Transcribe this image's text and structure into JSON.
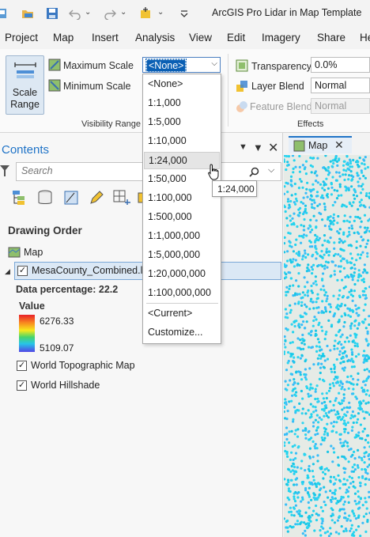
{
  "app": {
    "title": "ArcGIS Pro Lidar in Map Template"
  },
  "quick_access": [
    {
      "icon": "new-project-icon"
    },
    {
      "icon": "open-folder-icon"
    },
    {
      "icon": "save-icon"
    },
    {
      "icon": "undo-icon"
    },
    {
      "icon": "redo-icon"
    },
    {
      "icon": "new-item-icon"
    },
    {
      "icon": "customize-toolbar-icon"
    }
  ],
  "menu": {
    "tabs": [
      "Project",
      "Map",
      "Insert",
      "Analysis",
      "View",
      "Edit",
      "Imagery",
      "Share",
      "He"
    ]
  },
  "ribbon": {
    "scale_range": {
      "line1": "Scale",
      "line2": "Range"
    },
    "maximum_scale_label": "Maximum Scale",
    "maximum_scale_value": "<None>",
    "minimum_scale_label": "Minimum Scale",
    "visibility_group": "Visibility Range",
    "transparency_label": "Transparency",
    "transparency_value": "0.0%",
    "layer_blend_label": "Layer Blend",
    "layer_blend_value": "Normal",
    "feature_blend_label": "Feature Blend",
    "feature_blend_value": "Normal",
    "effects_group": "Effects"
  },
  "scale_dropdown": {
    "items": [
      "<None>",
      "1:1,000",
      "1:5,000",
      "1:10,000",
      "1:24,000",
      "1:50,000",
      "1:100,000",
      "1:500,000",
      "1:1,000,000",
      "1:5,000,000",
      "1:20,000,000",
      "1:100,000,000"
    ],
    "extra": [
      "<Current>",
      "Customize..."
    ],
    "hovered": "1:24,000",
    "tooltip": "1:24,000"
  },
  "contents": {
    "title": "Contents",
    "search_placeholder": "Search",
    "drawing_order": "Drawing Order",
    "map_name": "Map",
    "layer_name": "MesaCounty_Combined.las",
    "data_percentage": "Data percentage: 22.2",
    "value_label": "Value",
    "value_max": "6276.33",
    "value_min": "5109.07",
    "basemaps": [
      "World Topographic Map",
      "World Hillshade"
    ]
  },
  "map_tab": {
    "label": "Map"
  },
  "colors": {
    "accent": "#1f73c7",
    "selection": "#0a5fb4",
    "points": "#22d3ee"
  }
}
